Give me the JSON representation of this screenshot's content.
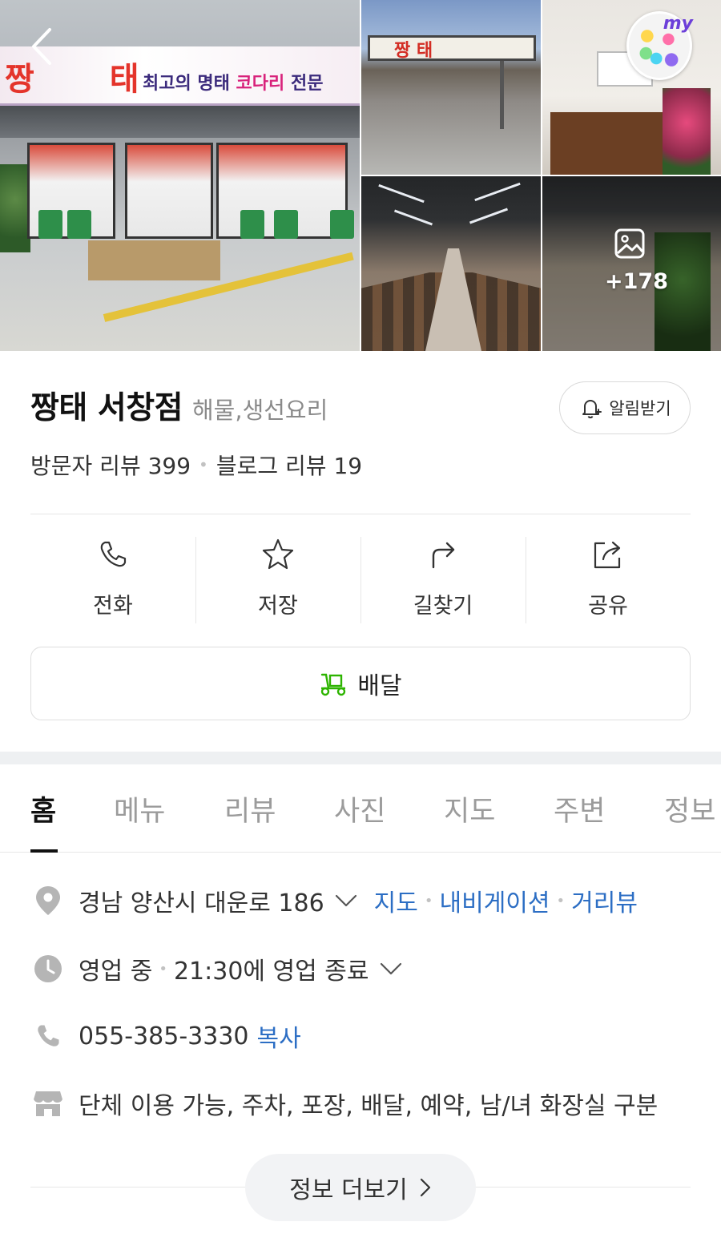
{
  "gallery": {
    "main_sign_logo": "짱 태",
    "main_sign_slogan_a": "최고의 명태",
    "main_sign_slogan_b": "코다리",
    "main_sign_slogan_c": "전문",
    "gate_sign": "짱 태",
    "my_badge_label": "my",
    "more_photos_count": "+178"
  },
  "place": {
    "name": "짱태 서창점",
    "category": "해물,생선요리",
    "alarm_label": "알림받기",
    "visitor_reviews": "방문자 리뷰 399",
    "blog_reviews": "블로그 리뷰 19"
  },
  "actions": [
    {
      "label": "전화",
      "icon": "phone-icon"
    },
    {
      "label": "저장",
      "icon": "star-icon"
    },
    {
      "label": "길찾기",
      "icon": "directions-icon"
    },
    {
      "label": "공유",
      "icon": "share-icon"
    }
  ],
  "delivery": {
    "label": "배달",
    "icon": "delivery-scooter-icon",
    "accent": "#2db400"
  },
  "tabs": [
    {
      "label": "홈",
      "active": true
    },
    {
      "label": "메뉴"
    },
    {
      "label": "리뷰"
    },
    {
      "label": "사진"
    },
    {
      "label": "지도"
    },
    {
      "label": "주변"
    },
    {
      "label": "정보"
    }
  ],
  "info": {
    "address": "경남 양산시 대운로 186",
    "address_links": [
      "지도",
      "내비게이션",
      "거리뷰"
    ],
    "hours_status": "영업 중",
    "hours_detail": "21:30에 영업 종료",
    "phone": "055-385-3330",
    "phone_copy": "복사",
    "amenities": "단체 이용 가능, 주차, 포장, 배달, 예약, 남/녀 화장실 구분"
  },
  "more_info_label": "정보 더보기",
  "colors": {
    "link": "#2c6ec4",
    "icon_gray": "#b5b5b5"
  }
}
